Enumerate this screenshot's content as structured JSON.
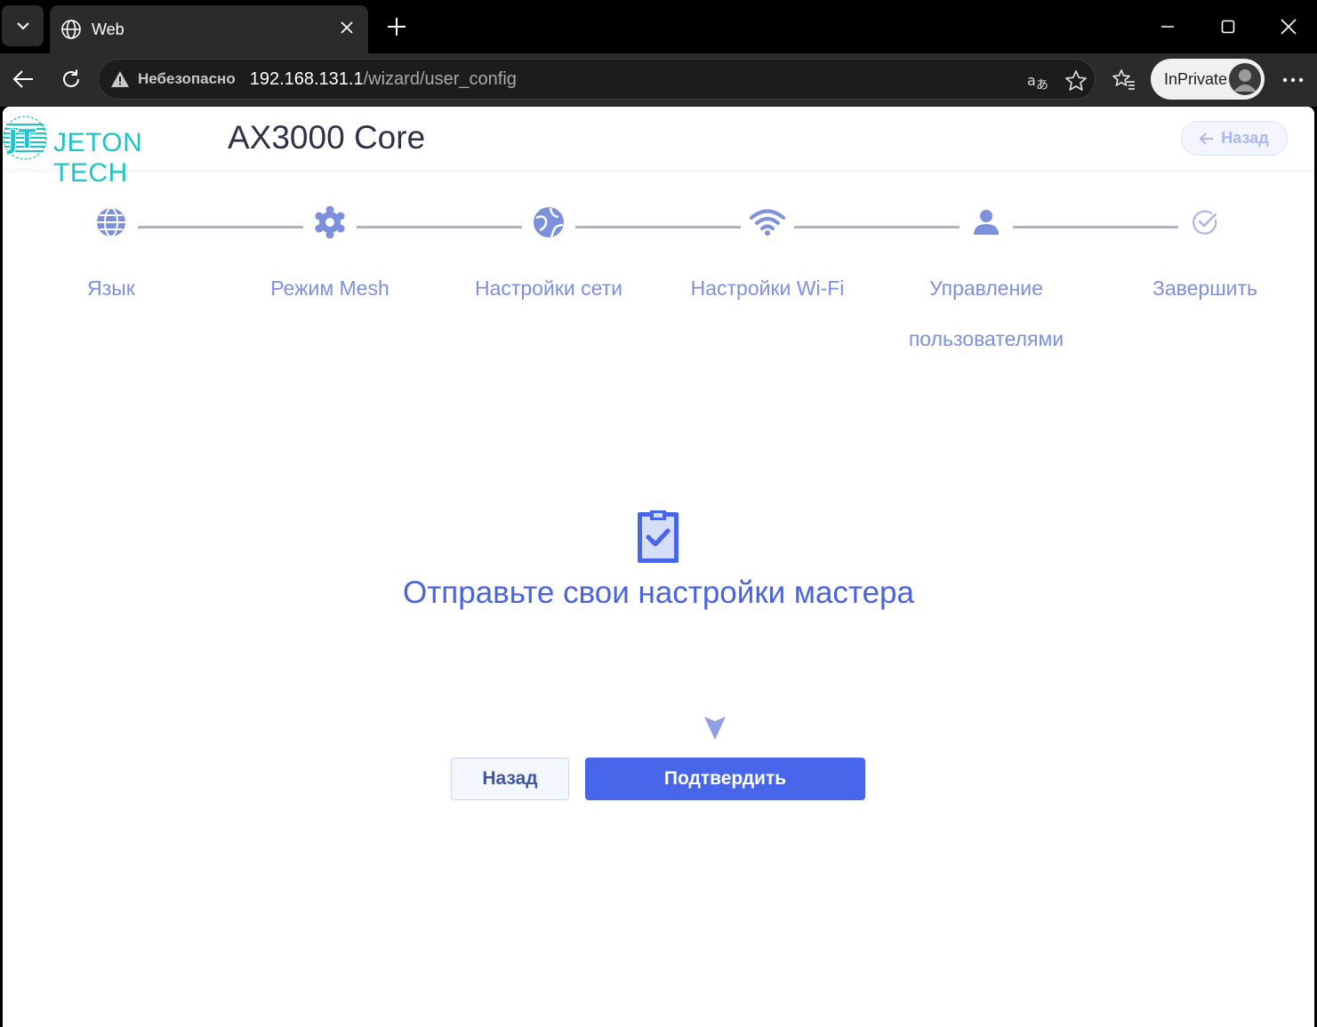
{
  "browser": {
    "tab_title": "Web",
    "security_label": "Небезопасно",
    "url_host": "192.168.131.1",
    "url_path": "/wizard/user_config",
    "profile_label": "InPrivate"
  },
  "header": {
    "brand": "JETON TECH",
    "product": "AX3000 Core",
    "back_label": "Назад"
  },
  "steps": [
    {
      "label": "Язык",
      "icon": "globe-icon"
    },
    {
      "label": "Режим Mesh",
      "icon": "gear-icon"
    },
    {
      "label": "Настройки сети",
      "icon": "network-globe-icon"
    },
    {
      "label": "Настройки Wi-Fi",
      "icon": "wifi-icon"
    },
    {
      "label": "Управление пользователями",
      "icon": "user-icon"
    },
    {
      "label": "Завершить",
      "icon": "check-circle-icon"
    }
  ],
  "main": {
    "title": "Отправьте свои настройки мастера",
    "back_button": "Назад",
    "confirm_button": "Подтвердить"
  },
  "colors": {
    "accent": "#4766e9",
    "step_color": "#7d90dd",
    "brand_color": "#1fc3c7"
  }
}
